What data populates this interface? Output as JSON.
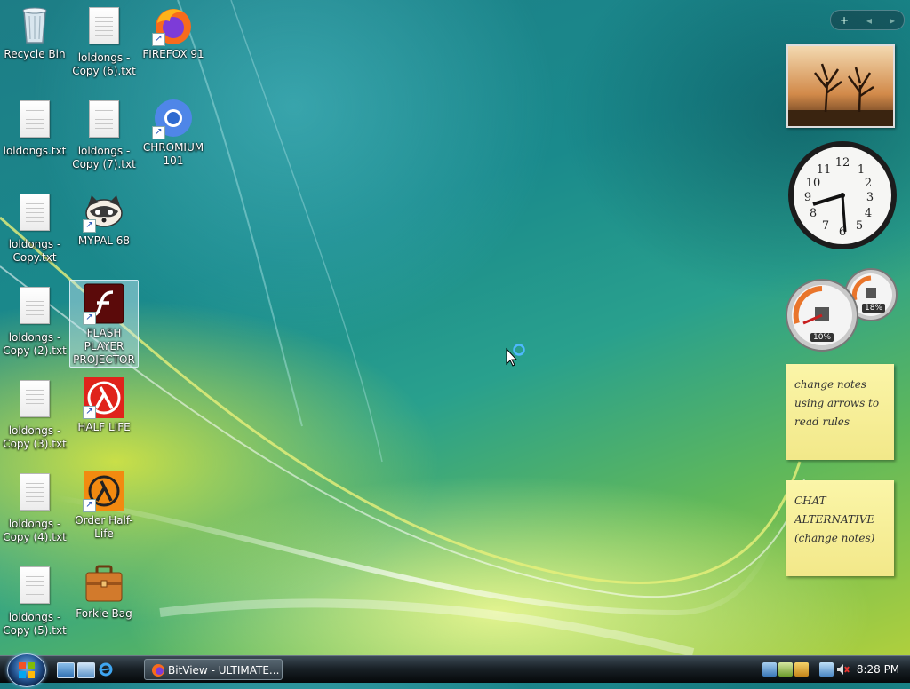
{
  "desktop": {
    "icons": [
      {
        "label": "Recycle Bin",
        "type": "recycle-bin"
      },
      {
        "label": "loldongs - Copy (6).txt",
        "type": "text-file"
      },
      {
        "label": "FIREFOX 91",
        "type": "shortcut"
      },
      {
        "label": "loldongs.txt",
        "type": "text-file"
      },
      {
        "label": "loldongs - Copy (7).txt",
        "type": "text-file"
      },
      {
        "label": "CHROMIUM 101",
        "type": "shortcut"
      },
      {
        "label": "loldongs - Copy.txt",
        "type": "text-file"
      },
      {
        "label": "MYPAL 68",
        "type": "shortcut"
      },
      {
        "label": "loldongs - Copy (2).txt",
        "type": "text-file"
      },
      {
        "label": "FLASH PLAYER PROJECTOR",
        "type": "shortcut",
        "selected": true
      },
      {
        "label": "loldongs - Copy (3).txt",
        "type": "text-file"
      },
      {
        "label": "HALF LIFE",
        "type": "shortcut"
      },
      {
        "label": "loldongs - Copy (4).txt",
        "type": "text-file"
      },
      {
        "label": "Order Half-Life",
        "type": "shortcut"
      },
      {
        "label": "loldongs - Copy (5).txt",
        "type": "text-file"
      },
      {
        "label": "Forkie Bag",
        "type": "folder"
      }
    ]
  },
  "sidebar": {
    "controls": {
      "add": "+",
      "prev": "◂",
      "next": "▸"
    },
    "cpu_meter": {
      "cpu": "10%",
      "memory": "18%"
    },
    "notes": [
      {
        "text": "change notes using arrows to read rules"
      },
      {
        "text": "CHAT ALTERNATIVE (change notes)"
      }
    ]
  },
  "taskbar": {
    "task": {
      "label": "BitView - ULTIMATE..."
    },
    "clock": {
      "time": "8:28 PM"
    }
  },
  "colors": {
    "note": "#fbf5a8",
    "taskbar": "#1a2228",
    "desktop": "#1a8a8c"
  }
}
